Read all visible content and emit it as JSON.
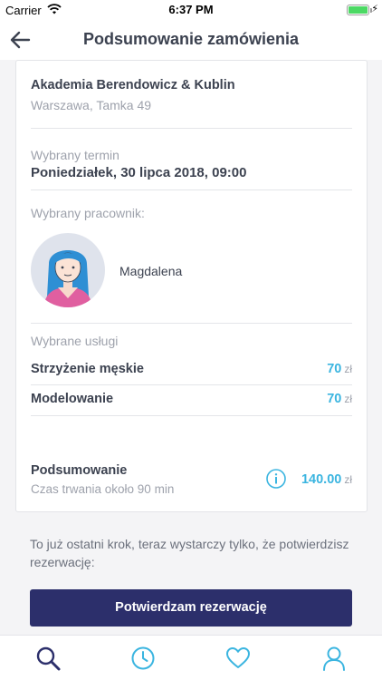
{
  "status_bar": {
    "carrier": "Carrier",
    "time": "6:37 PM"
  },
  "nav": {
    "title": "Podsumowanie zamówienia",
    "back_icon": "arrow-left-icon"
  },
  "salon": {
    "name": "Akademia Berendowicz & Kublin",
    "address": "Warszawa, Tamka 49"
  },
  "term": {
    "label": "Wybrany termin",
    "value": "Poniedziałek, 30 lipca 2018, 09:00"
  },
  "employee": {
    "label": "Wybrany pracownik:",
    "name": "Magdalena"
  },
  "services": {
    "label": "Wybrane usługi",
    "items": [
      {
        "name": "Strzyżenie męskie",
        "price": "70",
        "currency": "zł"
      },
      {
        "name": "Modelowanie",
        "price": "70",
        "currency": "zł"
      }
    ]
  },
  "summary": {
    "title": "Podsumowanie",
    "duration": "Czas trwania około 90 min",
    "total": "140.00",
    "currency": "zł"
  },
  "note": "To już ostatni krok, teraz wystarczy tylko, że potwierdzisz rezerwację:",
  "confirm_button": "Potwierdzam rezerwację",
  "tabs": [
    {
      "icon": "search-icon",
      "active": true
    },
    {
      "icon": "clock-icon",
      "active": false
    },
    {
      "icon": "heart-icon",
      "active": false
    },
    {
      "icon": "user-icon",
      "active": false
    }
  ],
  "colors": {
    "primary": "#2c2f6b",
    "accent": "#3bb5e0",
    "text": "#3c4250",
    "muted": "#9ea2ac",
    "battery": "#4cd964"
  }
}
